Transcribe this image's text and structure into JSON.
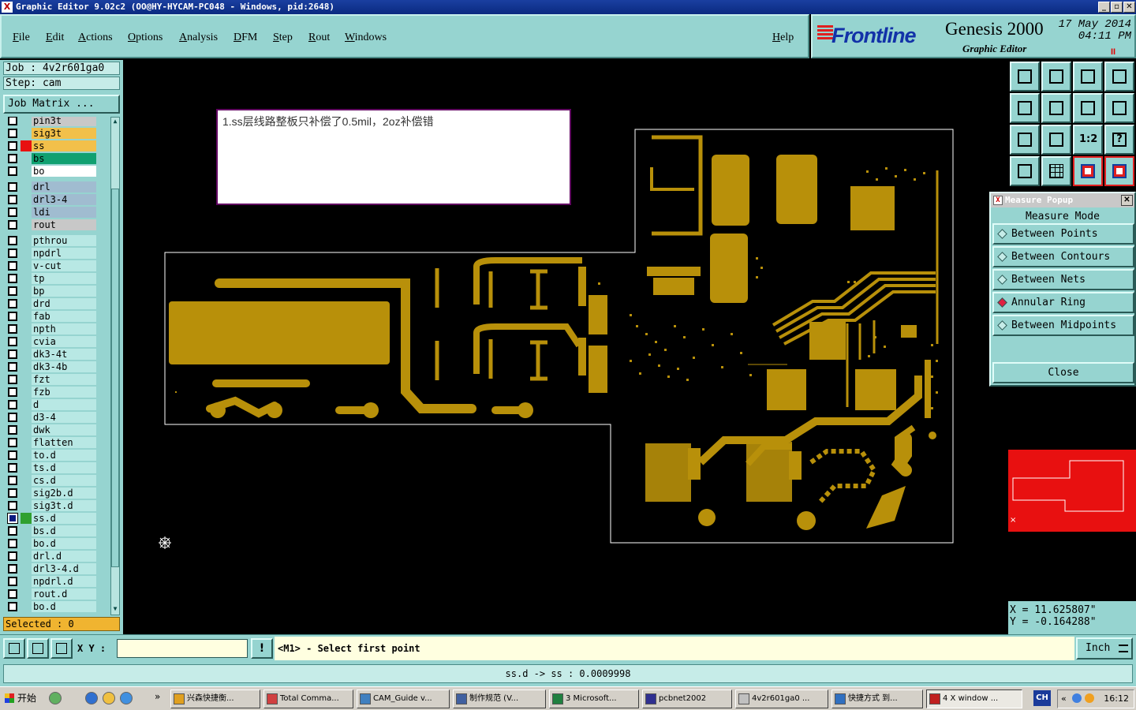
{
  "window": {
    "title": "Graphic Editor 9.02c2 (OO@HY-HYCAM-PC048 - Windows, pid:2648)",
    "icon_label": "X",
    "min": "_",
    "max": "▫",
    "close": "✕"
  },
  "menu": [
    {
      "label": "File"
    },
    {
      "label": "Edit"
    },
    {
      "label": "Actions"
    },
    {
      "label": "Options"
    },
    {
      "label": "Analysis"
    },
    {
      "label": "DFM"
    },
    {
      "label": "Step"
    },
    {
      "label": "Rout"
    },
    {
      "label": "Windows"
    }
  ],
  "menu_help": "Help",
  "brand": {
    "logo": "Frontline",
    "product": "Genesis 2000",
    "sub": "Graphic Editor",
    "date": "17 May 2014",
    "time": "04:11 PM",
    "pause": "II"
  },
  "job": {
    "job_line": "Job : 4v2r601ga0",
    "step_line": "Step: cam",
    "matrix_button": "Job Matrix ..."
  },
  "layers": [
    {
      "name": "pin3t",
      "color": "#c8c8c8",
      "sw": "",
      "checked": false
    },
    {
      "name": "sig3t",
      "color": "#f2c04a",
      "sw": "",
      "checked": false
    },
    {
      "name": "ss",
      "color": "#f2c04a",
      "sw": "#e81010",
      "checked": false
    },
    {
      "name": "bs",
      "color": "#10a070",
      "sw": "",
      "checked": false
    },
    {
      "name": "bo",
      "color": "#ffffff",
      "sw": "",
      "checked": false
    },
    {
      "name": "drl",
      "color": "#a0bcd0",
      "sw": "",
      "checked": false
    },
    {
      "name": "drl3-4",
      "color": "#a0bcd0",
      "sw": "",
      "checked": false
    },
    {
      "name": "ldi",
      "color": "#a0bcd0",
      "sw": "",
      "checked": false
    },
    {
      "name": "rout",
      "color": "#c8c8c8",
      "sw": "",
      "checked": false
    },
    {
      "name": "pthrou",
      "color": "#b8e8e4",
      "sw": "",
      "checked": false
    },
    {
      "name": "npdrl",
      "color": "#b8e8e4",
      "sw": "",
      "checked": false
    },
    {
      "name": "v-cut",
      "color": "#b8e8e4",
      "sw": "",
      "checked": false
    },
    {
      "name": "tp",
      "color": "#b8e8e4",
      "sw": "",
      "checked": false
    },
    {
      "name": "bp",
      "color": "#b8e8e4",
      "sw": "",
      "checked": false
    },
    {
      "name": "drd",
      "color": "#b8e8e4",
      "sw": "",
      "checked": false
    },
    {
      "name": "fab",
      "color": "#b8e8e4",
      "sw": "",
      "checked": false
    },
    {
      "name": "npth",
      "color": "#b8e8e4",
      "sw": "",
      "checked": false
    },
    {
      "name": "cvia",
      "color": "#b8e8e4",
      "sw": "",
      "checked": false
    },
    {
      "name": "dk3-4t",
      "color": "#b8e8e4",
      "sw": "",
      "checked": false
    },
    {
      "name": "dk3-4b",
      "color": "#b8e8e4",
      "sw": "",
      "checked": false
    },
    {
      "name": "fzt",
      "color": "#b8e8e4",
      "sw": "",
      "checked": false
    },
    {
      "name": "fzb",
      "color": "#b8e8e4",
      "sw": "",
      "checked": false
    },
    {
      "name": "d",
      "color": "#b8e8e4",
      "sw": "",
      "checked": false
    },
    {
      "name": "d3-4",
      "color": "#b8e8e4",
      "sw": "",
      "checked": false
    },
    {
      "name": "dwk",
      "color": "#b8e8e4",
      "sw": "",
      "checked": false
    },
    {
      "name": "flatten",
      "color": "#b8e8e4",
      "sw": "",
      "checked": false
    },
    {
      "name": "to.d",
      "color": "#b8e8e4",
      "sw": "",
      "checked": false
    },
    {
      "name": "ts.d",
      "color": "#b8e8e4",
      "sw": "",
      "checked": false
    },
    {
      "name": "cs.d",
      "color": "#b8e8e4",
      "sw": "",
      "checked": false
    },
    {
      "name": "sig2b.d",
      "color": "#b8e8e4",
      "sw": "",
      "checked": false
    },
    {
      "name": "sig3t.d",
      "color": "#b8e8e4",
      "sw": "",
      "checked": false
    },
    {
      "name": "ss.d",
      "color": "#b8e8e4",
      "sw": "#30a030",
      "checked": true
    },
    {
      "name": "bs.d",
      "color": "#b8e8e4",
      "sw": "",
      "checked": false
    },
    {
      "name": "bo.d",
      "color": "#b8e8e4",
      "sw": "",
      "checked": false
    },
    {
      "name": "drl.d",
      "color": "#b8e8e4",
      "sw": "",
      "checked": false
    },
    {
      "name": "drl3-4.d",
      "color": "#b8e8e4",
      "sw": "",
      "checked": false
    },
    {
      "name": "npdrl.d",
      "color": "#b8e8e4",
      "sw": "",
      "checked": false
    },
    {
      "name": "rout.d",
      "color": "#b8e8e4",
      "sw": "",
      "checked": false
    },
    {
      "name": "bo.d",
      "color": "#b8e8e4",
      "sw": "",
      "checked": false
    }
  ],
  "selected": "Selected : 0",
  "canvas": {
    "note": "1.ss层线路整板只补偿了0.5mil，2oz补偿错",
    "trace_color": "#b8900a",
    "outline_color": "#ffffff"
  },
  "toolbar_icons": [
    "zoom-home-icon",
    "zoom-fit-icon",
    "house-icon",
    "window-split-icon",
    "pan-left-icon",
    "pan-right-icon",
    "flip-icon",
    "snap-icon",
    "zoom-in-icon",
    "zoom-out-icon",
    "scale-1-2-icon",
    "help-icon",
    "tool-settings-icon",
    "grid-icon",
    "net-red-icon",
    "net-red2-icon"
  ],
  "scale_label": "1:2",
  "help_label": "?",
  "measure": {
    "title": "Measure Popup",
    "mode_label": "Measure Mode",
    "options": [
      {
        "label": "Between Points",
        "selected": false
      },
      {
        "label": "Between Contours",
        "selected": false
      },
      {
        "label": "Between Nets",
        "selected": false
      },
      {
        "label": "Annular Ring",
        "selected": true
      },
      {
        "label": "Between Midpoints",
        "selected": false
      }
    ],
    "close_label": "Close",
    "close_x": "✕"
  },
  "coords": {
    "x": "X = 11.625807\"",
    "y": "Y = -0.164288\""
  },
  "bottom": {
    "xy_label": "X Y :",
    "xy_value": "",
    "warn": "!",
    "prompt": "<M1> - Select first point",
    "unit": "Inch"
  },
  "status": "ss.d -> ss : 0.0009998",
  "taskbar": {
    "start": "开始",
    "quick_more": "»",
    "tasks": [
      {
        "label": "兴森快捷衡...",
        "icon": "#e0a020",
        "active": false
      },
      {
        "label": "Total Comma...",
        "icon": "#d04040",
        "active": false
      },
      {
        "label": "CAM_Guide v...",
        "icon": "#4080c0",
        "active": false
      },
      {
        "label": "制作规范 (V...",
        "icon": "#4060a0",
        "active": false
      },
      {
        "label": "3 Microsoft...",
        "icon": "#208040",
        "active": false
      },
      {
        "label": "pcbnet2002",
        "icon": "#303090",
        "active": false
      },
      {
        "label": "4v2r601ga0 ...",
        "icon": "#c0c0c0",
        "active": false
      },
      {
        "label": "快捷方式 到...",
        "icon": "#3070c0",
        "active": false
      },
      {
        "label": "4 X window ...",
        "icon": "#c02020",
        "active": true
      }
    ],
    "ime": "CH",
    "tray_arrow": "«",
    "clock": "16:12"
  }
}
